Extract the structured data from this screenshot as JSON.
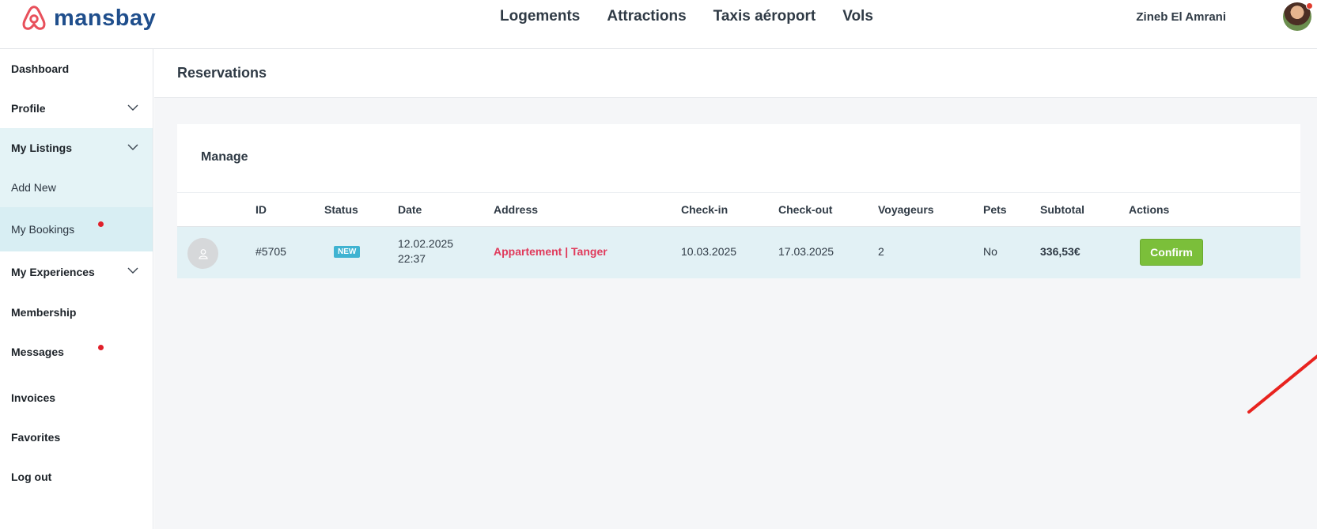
{
  "brand": {
    "name": "mansbay",
    "logo_icon": "airbnb-like-logo-icon",
    "color": "#1f4e8c",
    "logo_color": "#e8505b"
  },
  "topnav": {
    "items": [
      "Logements",
      "Attractions",
      "Taxis aéroport",
      "Vols"
    ]
  },
  "user": {
    "name": "Zineb El Amrani",
    "avatar_icon": "avatar-icon",
    "notification_color": "#e03c2e"
  },
  "sidebar": {
    "items": [
      {
        "label": "Dashboard"
      },
      {
        "label": "Profile",
        "icon": "chevron-down-icon"
      },
      {
        "label": "My Listings",
        "icon": "chevron-down-icon"
      },
      {
        "label": "Add New"
      },
      {
        "label": "My Bookings",
        "badge_color": "#e0202a"
      },
      {
        "label": "My Experiences",
        "icon": "chevron-down-icon"
      },
      {
        "label": "Membership"
      },
      {
        "label": "Messages",
        "badge_color": "#e0202a"
      },
      {
        "label": "Invoices"
      },
      {
        "label": "Favorites"
      },
      {
        "label": "Log out"
      }
    ]
  },
  "main": {
    "title": "Reservations",
    "card_title": "Manage",
    "table": {
      "columns": [
        "ID",
        "Status",
        "Date",
        "Address",
        "Check-in",
        "Check-out",
        "Voyageurs",
        "Pets",
        "Subtotal",
        "Actions"
      ],
      "rows": [
        {
          "id": "#5705",
          "status": "NEW",
          "date": "12.02.2025",
          "time": "22:37",
          "address": "Appartement | Tanger",
          "checkin": "10.03.2025",
          "checkout": "17.03.2025",
          "voyageurs": "2",
          "pets": "No",
          "subtotal": "336,53€",
          "action": "Confirm"
        }
      ]
    }
  },
  "colors": {
    "confirm": "#7bbf3a",
    "status_new": "#3fb3d1",
    "address": "#e03a5b",
    "row_bg": "#e2f1f5",
    "annotation_arrow": "#e8231f"
  }
}
